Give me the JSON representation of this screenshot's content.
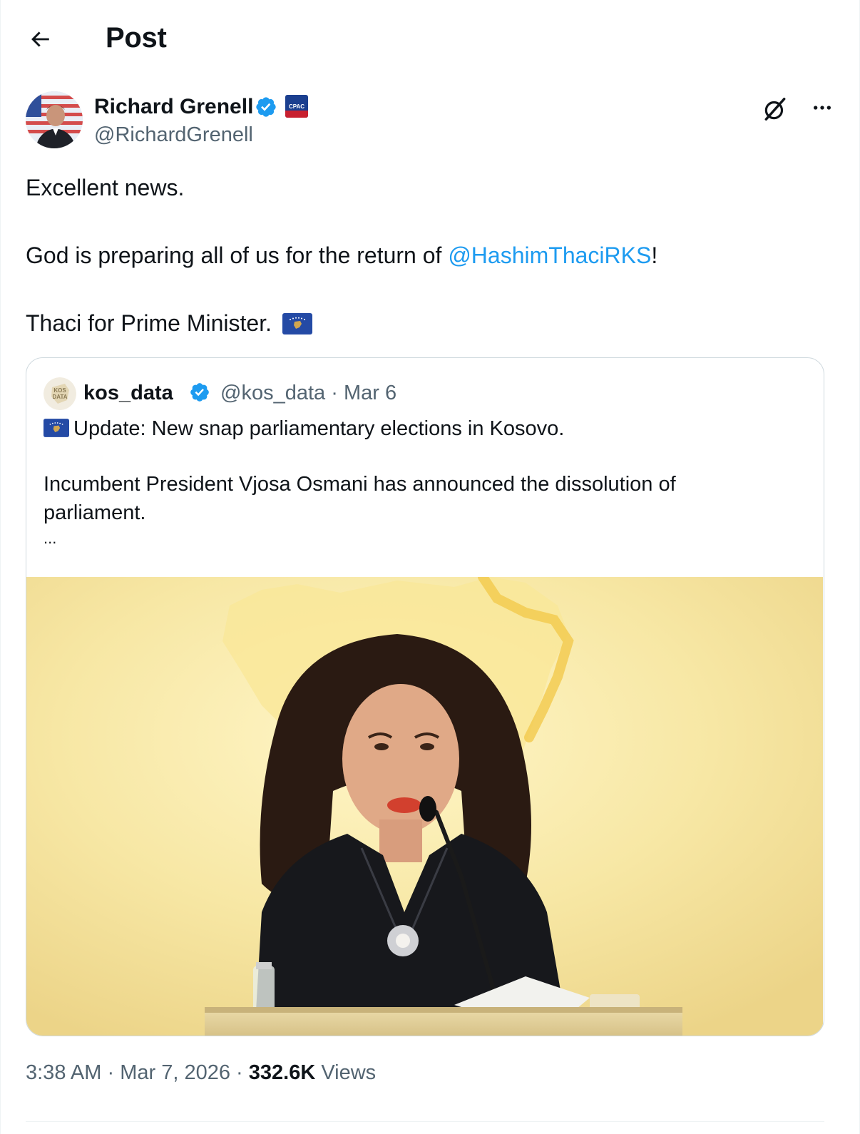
{
  "header": {
    "title": "Post",
    "back_icon": "arrow-left-icon"
  },
  "author": {
    "display_name": "Richard Grenell",
    "handle": "@RichardGrenell",
    "verified_icon": "verified-badge-icon",
    "affiliation_badge": "cpac-badge"
  },
  "post": {
    "line1": "Excellent news.",
    "line2_before": "God is preparing all of us for the return of ",
    "mention": "@HashimThaciRKS",
    "line2_after": "!",
    "line3": "Thaci for Prime Minister."
  },
  "quote": {
    "display_name": "kos_data",
    "handle": "@kos_data",
    "separator": "·",
    "date": "Mar 6",
    "line1": "Update: New snap parliamentary elections in Kosovo.",
    "line2": "Incumbent President Vjosa Osmani has announced the dissolution of",
    "line3": "parliament.",
    "ellipsis": "..."
  },
  "meta": {
    "time": "3:38 AM",
    "sep1": "·",
    "date": "Mar 7, 2026",
    "sep2": "·",
    "views_count": "332.6K",
    "views_label": "Views"
  },
  "colors": {
    "text": "#0f1419",
    "secondary": "#536471",
    "link": "#1d9bf0",
    "verified": "#1d9bf0",
    "border": "#cfd9de",
    "kosovo_flag_blue": "#244aa5",
    "kosovo_flag_gold": "#d0a650"
  }
}
